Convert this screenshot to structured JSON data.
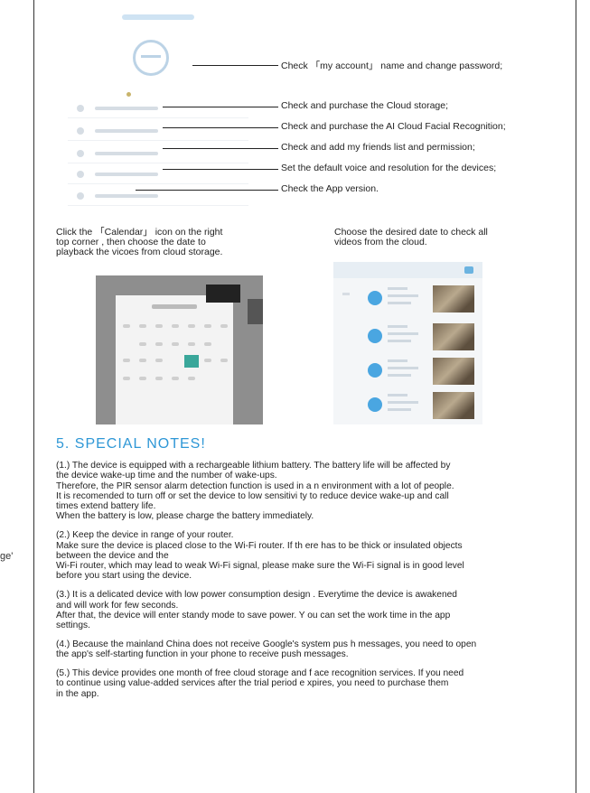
{
  "stray_text": "ge'",
  "account_callouts": [
    "Check 「my account」 name and change password;",
    "Check and purchase the Cloud storage;",
    "Check and purchase the AI Cloud Facial Recognition;",
    "Check and add my friends list and permission;",
    "Set the default voice and resolution for the devices;",
    "Check the App version."
  ],
  "calendar_caption": [
    "Click the 「Calendar」 icon on the right",
    "top corner , then choose the date to",
    "playback the vicoes from cloud storage."
  ],
  "videos_caption": [
    "Choose the desired date to check all",
    "videos from the cloud."
  ],
  "section_title": "5. SPECIAL NOTES!",
  "notes": [
    [
      "(1.) The device is equipped with a rechargeable lithium battery. The battery life will be affected by",
      "the device wake-up time and the number of wake-ups.",
      "Therefore, the PIR sensor alarm detection function is used in a  n environment with a lot of people.",
      "It is recomended to turn off or set the device to low sensitivi  ty to reduce device wake-up and call",
      "times extend battery life.",
      "When the battery is low, please charge the battery immediately."
    ],
    [
      "(2.) Keep the device in range of your router.",
      "Make sure the device is placed close to the Wi-Fi router. If th   ere has to be thick or insulated objects",
      "between the device and the",
      "Wi-Fi router, which may lead to weak Wi-Fi signal, please make    sure the Wi-Fi signal is in good level",
      "before you start using the device."
    ],
    [
      "(3.) It is a delicated device with low power consumption design . Everytime the device is awakened",
      "and will work for few seconds.",
      "After that, the device will enter standy mode to save power.  Y  ou can set the work time in the app",
      "settings."
    ],
    [
      "(4.) Because the mainland China does not receive Google's system pus  h messages, you need to open",
      "the app's self-starting function in your phone to receive push   messages."
    ],
    [
      "(5.) This device provides one month of free cloud storage and  f  ace recognition services. If you need",
      "to continue using value-added services after the trial period e  xpires, you need to purchase them",
      "in the app."
    ]
  ]
}
